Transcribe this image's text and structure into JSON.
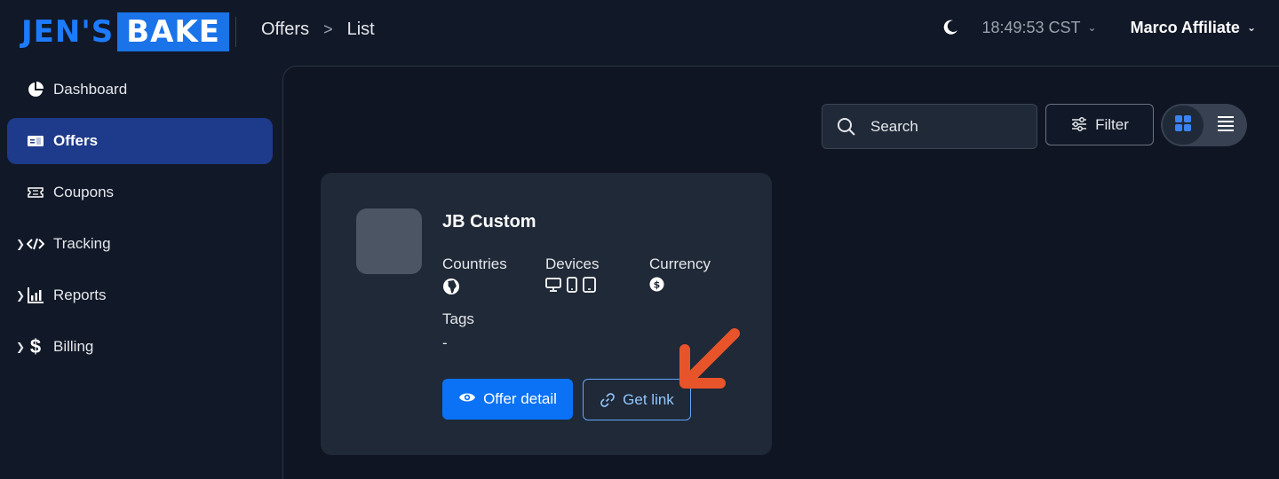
{
  "header": {
    "logo": {
      "part1": "JEN'S",
      "part2": "BAKE"
    },
    "breadcrumb": [
      "Offers",
      "List"
    ],
    "breadcrumb_separator": ">",
    "time": "18:49:53 CST",
    "user": "Marco Affiliate"
  },
  "sidebar": {
    "items": [
      {
        "label": "Dashboard",
        "icon": "pie-chart-icon",
        "expandable": false,
        "active": false
      },
      {
        "label": "Offers",
        "icon": "id-card-icon",
        "expandable": false,
        "active": true
      },
      {
        "label": "Coupons",
        "icon": "ticket-icon",
        "expandable": false,
        "active": false
      },
      {
        "label": "Tracking",
        "icon": "code-icon",
        "expandable": true,
        "active": false
      },
      {
        "label": "Reports",
        "icon": "bar-chart-icon",
        "expandable": true,
        "active": false
      },
      {
        "label": "Billing",
        "icon": "dollar-icon",
        "expandable": true,
        "active": false
      }
    ]
  },
  "toolbar": {
    "search_placeholder": "Search",
    "filter_label": "Filter",
    "view_mode": "grid"
  },
  "offer_card": {
    "title": "JB Custom",
    "countries_label": "Countries",
    "devices_label": "Devices",
    "currency_label": "Currency",
    "tags_label": "Tags",
    "tags_value": "-",
    "offer_detail_label": "Offer detail",
    "get_link_label": "Get link"
  },
  "colors": {
    "accent": "#0b72f5",
    "active_nav": "#1e3a8a",
    "annotation_arrow": "#e8542a"
  }
}
